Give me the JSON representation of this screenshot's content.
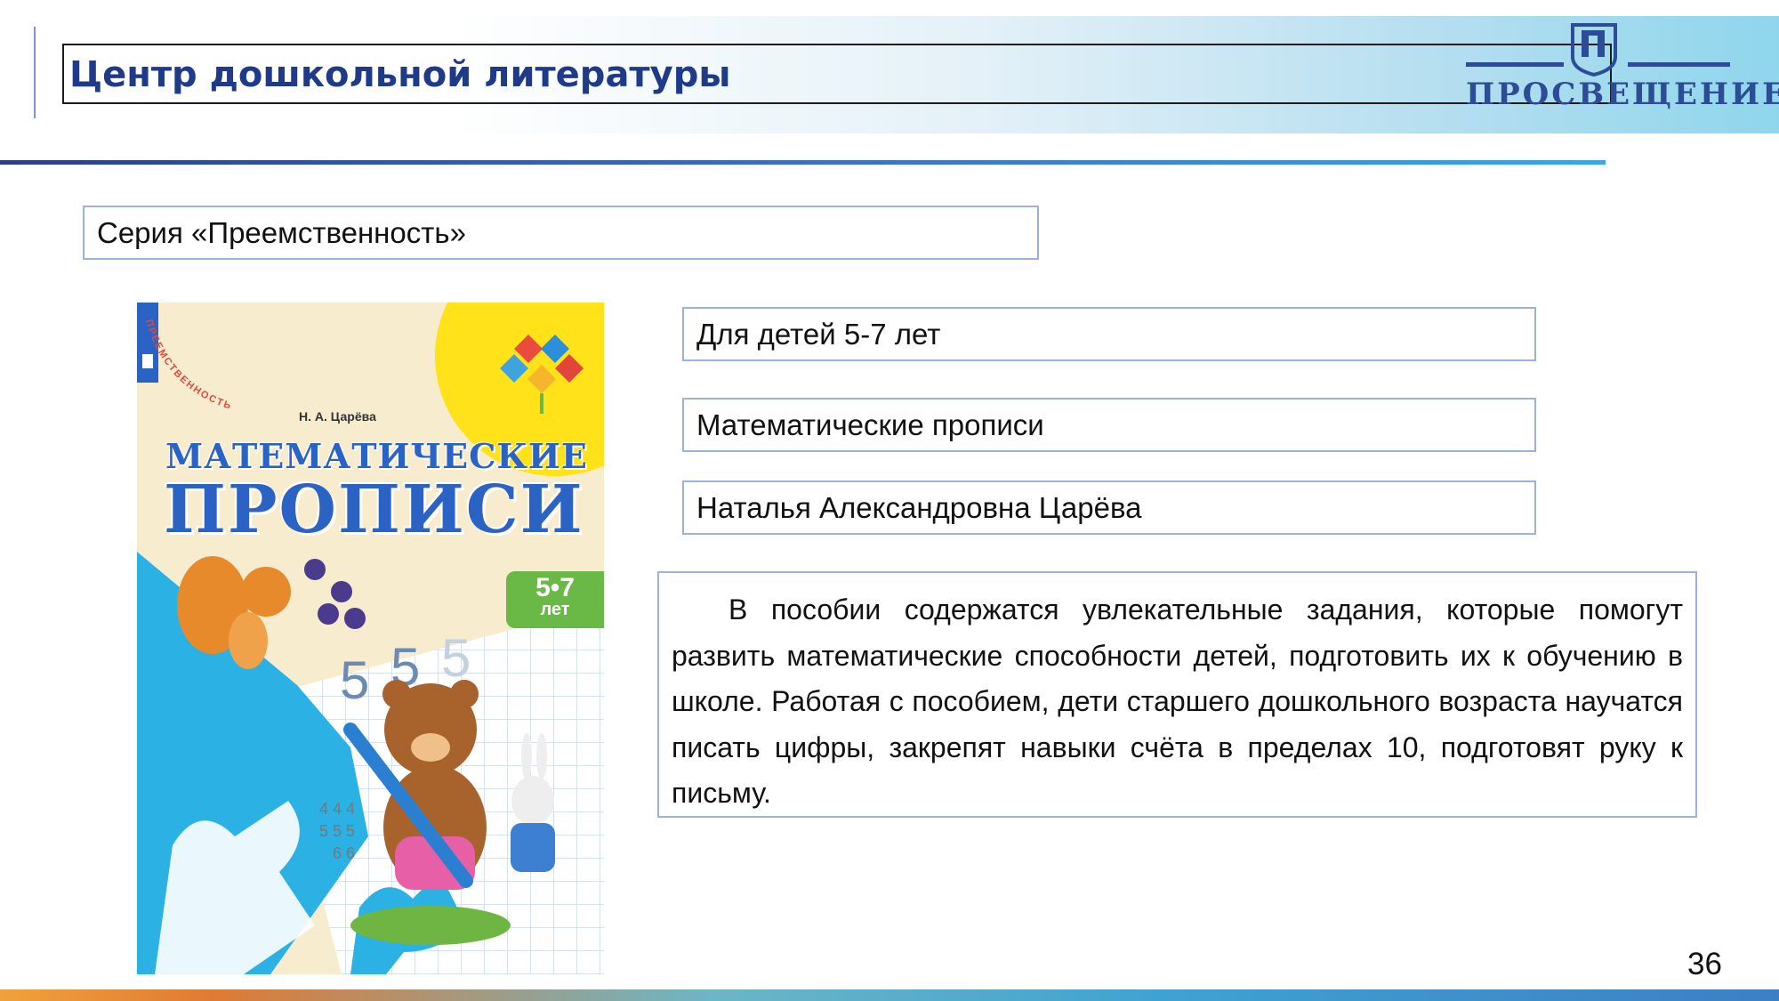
{
  "header": {
    "title": "Центр дошкольной литературы",
    "logo_text": "ПРОСВЕЩЕНИЕ",
    "logo_icon": "prosveshchenie-emblem-icon"
  },
  "series_label": "Серия «Преемственность»",
  "book": {
    "age": "Для детей 5-7 лет",
    "title": "Математические прописи",
    "author": "Наталья Александровна Царёва",
    "description": "В пособии содержатся увлекательные задания, которые помогут развить математические способности детей, подготовить их к обучению в школе. Работая с пособием, дети старшего дошкольного возраста научатся писать цифры, закрепят навыки счёта в пределах 10, подготовят руку к письму."
  },
  "cover": {
    "author": "Н. А. Царёва",
    "title_line1": "МАТЕМАТИЧЕСКИЕ",
    "title_line2": "ПРОПИСИ",
    "age_num": "5•7",
    "age_unit": "лет",
    "series_arc": "ПРЕЕМСТВЕННОСТЬ"
  },
  "page_number": "36",
  "colors": {
    "title_blue": "#1f3a88",
    "box_border": "#9bb3d8",
    "logo_blue": "#2c4c95"
  }
}
